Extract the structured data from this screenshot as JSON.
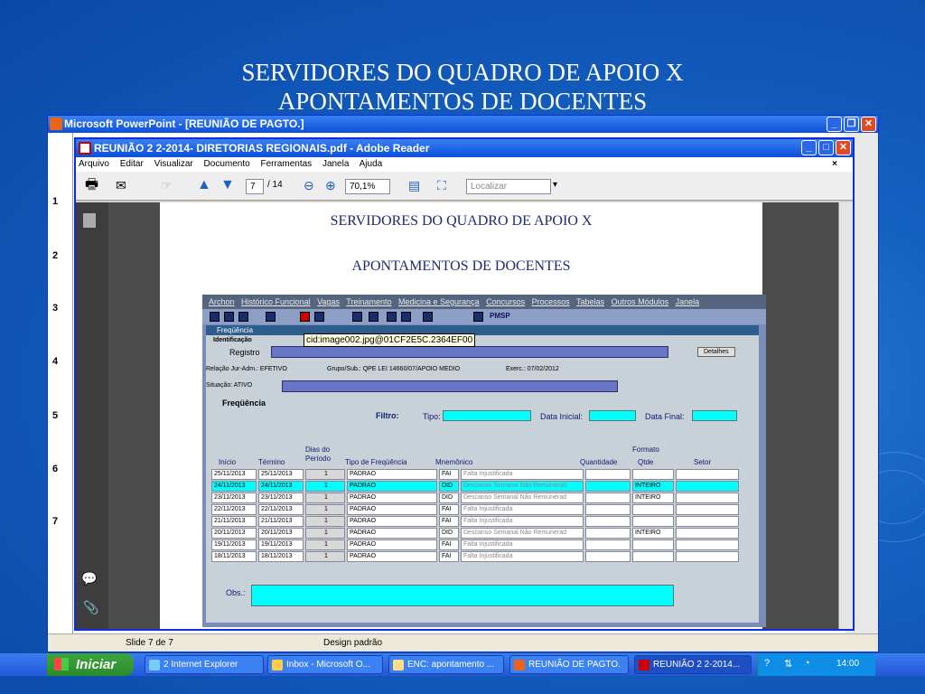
{
  "slide": {
    "title_line1": "SERVIDORES DO QUADRO DE APOIO X",
    "title_line2": "APONTAMENTOS DE DOCENTES"
  },
  "ppt": {
    "window_title": "Microsoft PowerPoint - [REUNIÃO DE PAGTO.]",
    "slide_numbers": [
      "1",
      "2",
      "3",
      "4",
      "5",
      "6",
      "7"
    ],
    "status_slide": "Slide 7 de 7",
    "status_design": "Design padrão"
  },
  "reader": {
    "window_title": "REUNIÃO 2 2-2014- DIRETORIAS REGIONAIS.pdf - Adobe Reader",
    "menu": [
      "Arquivo",
      "Editar",
      "Visualizar",
      "Documento",
      "Ferramentas",
      "Janela",
      "Ajuda"
    ],
    "menu_close": "×",
    "page_current": "7",
    "page_total": "/ 14",
    "zoom": "70,1%",
    "search_placeholder": "Localizar"
  },
  "doc": {
    "title1": "SERVIDORES DO QUADRO DE APOIO  X",
    "title2": "APONTAMENTOS DE DOCENTES"
  },
  "app": {
    "menu": [
      "Archon",
      "Histórico Funcional",
      "Vagas",
      "Treinamento",
      "Medicina e Segurança",
      "Concursos",
      "Processos",
      "Tabelas",
      "Outros Módulos",
      "Janela"
    ],
    "pmsp": "PMSP",
    "frame_title": "Freqüência",
    "tooltip": "cid:image002.jpg@01CF2E5C.2364EF00",
    "ident_label": "Identificação",
    "registro_label": "Registro",
    "detalhes_button": "Detalhes",
    "relacao": "Relação Jur-Adm.: EFETIVO",
    "grupo": "Grupo/Sub.: QPE LEI 14660/07/APOIO MEDIO",
    "exerc": "Exerc.: 07/02/2012",
    "situacao": "Situação: ATIVO",
    "freq_label": "Freqüência",
    "filtro": "Filtro:",
    "tipo": "Tipo:",
    "data_inicial": "Data Inicial:",
    "data_final": "Data Final:",
    "headers": {
      "inicio": "Início",
      "termino": "Término",
      "dias1": "Dias do",
      "dias2": "Período",
      "tipo": "Tipo de Freqüência",
      "mnem": "Mnemônico",
      "qtd": "Quantidade",
      "fmt1": "Formato",
      "fmt2": "Qtde",
      "setor": "Setor"
    },
    "rows": [
      {
        "inicio": "25/11/2013",
        "termino": "25/11/2013",
        "dias": "1",
        "tipo": "PADRAO",
        "mnem": "FAI",
        "desc": "Falta Injustificada",
        "formato": ""
      },
      {
        "inicio": "24/11/2013",
        "termino": "24/11/2013",
        "dias": "1",
        "tipo": "PADRAO",
        "mnem": "DID",
        "desc": "Descanso Semanal Não Remunerad",
        "formato": "INTEIRO"
      },
      {
        "inicio": "23/11/2013",
        "termino": "23/11/2013",
        "dias": "1",
        "tipo": "PADRAO",
        "mnem": "DID",
        "desc": "Descanso Semanal Não Remunerad",
        "formato": "INTEIRO"
      },
      {
        "inicio": "22/11/2013",
        "termino": "22/11/2013",
        "dias": "1",
        "tipo": "PADRAO",
        "mnem": "FAI",
        "desc": "Falta Injustificada",
        "formato": ""
      },
      {
        "inicio": "21/11/2013",
        "termino": "21/11/2013",
        "dias": "1",
        "tipo": "PADRAO",
        "mnem": "FAI",
        "desc": "Falta Injustificada",
        "formato": ""
      },
      {
        "inicio": "20/11/2013",
        "termino": "20/11/2013",
        "dias": "1",
        "tipo": "PADRAO",
        "mnem": "DID",
        "desc": "Descanso Semanal Não Remunerad",
        "formato": "INTEIRO"
      },
      {
        "inicio": "19/11/2013",
        "termino": "19/11/2013",
        "dias": "1",
        "tipo": "PADRAO",
        "mnem": "FAI",
        "desc": "Falta Injustificada",
        "formato": ""
      },
      {
        "inicio": "18/11/2013",
        "termino": "18/11/2013",
        "dias": "1",
        "tipo": "PADRAO",
        "mnem": "FAI",
        "desc": "Falta Injustificada",
        "formato": ""
      }
    ],
    "obs_label": "Obs.:"
  },
  "taskbar": {
    "start": "Iniciar",
    "tasks": [
      "2 Internet Explorer",
      "Inbox - Microsoft O...",
      "ENC: apontamento ...",
      "REUNIÃO DE PAGTO.",
      "REUNIÃO 2 2-2014..."
    ],
    "clock": "14:00"
  },
  "colors": {
    "highlight": "#00ffff",
    "titlebar": "#0c4fd9",
    "taskbar": "#2458d8"
  }
}
